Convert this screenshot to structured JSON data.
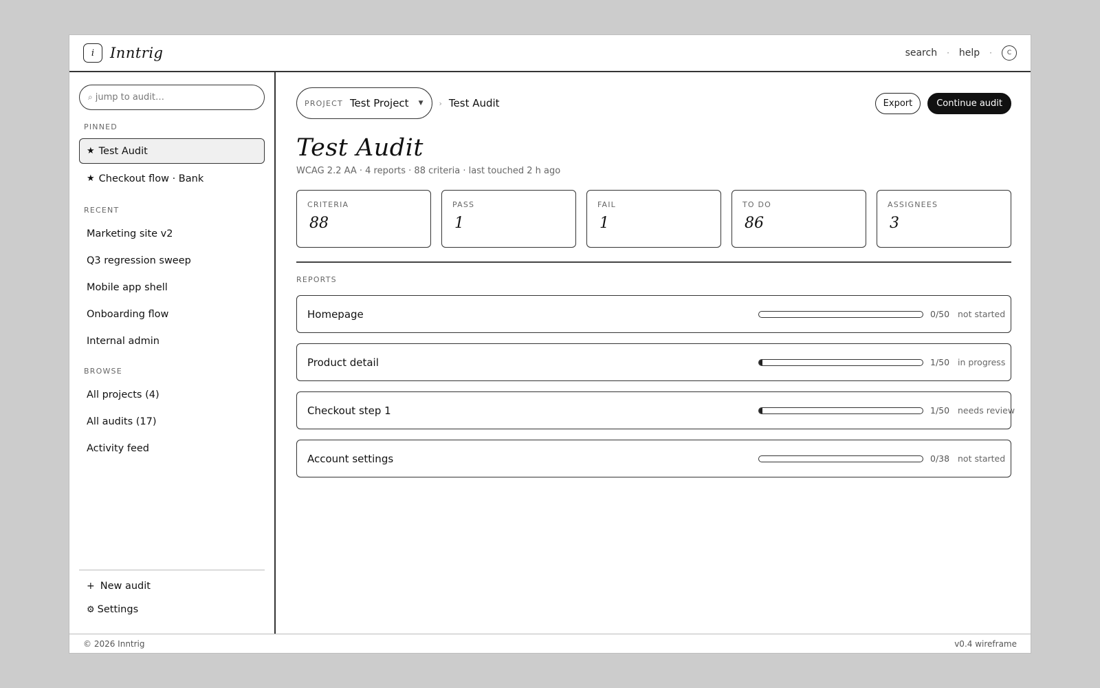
{
  "app": {
    "logo_glyph": "i",
    "brand": "Inntrig"
  },
  "topbar": {
    "search": "search",
    "separator": "·",
    "help": "help",
    "avatar_initial": "C"
  },
  "sidebar": {
    "search_placeholder": "jump to audit…",
    "search_icon": "search-icon",
    "pinned_label": "PINNED",
    "pinned": [
      {
        "label": "Test Audit",
        "active": true
      },
      {
        "label": "Checkout flow · Bank",
        "active": false
      }
    ],
    "recent_label": "RECENT",
    "recent": [
      {
        "label": "Marketing site v2"
      },
      {
        "label": "Q3 regression sweep"
      },
      {
        "label": "Mobile app shell"
      },
      {
        "label": "Onboarding flow"
      },
      {
        "label": "Internal admin"
      }
    ],
    "browse_label": "BROWSE",
    "browse": [
      {
        "label": "All projects (4)"
      },
      {
        "label": "All audits (17)"
      },
      {
        "label": "Activity feed"
      }
    ],
    "new_audit": "New audit",
    "settings": "Settings"
  },
  "breadcrumb": {
    "project_label": "PROJECT",
    "project_value": "Test Project",
    "current": "Test Audit"
  },
  "actions": {
    "export": "Export",
    "continue": "Continue audit"
  },
  "page": {
    "title": "Test Audit",
    "meta": "WCAG 2.2 AA · 4 reports · 88 criteria · last touched 2 h ago"
  },
  "stats": [
    {
      "label": "CRITERIA",
      "value": "88"
    },
    {
      "label": "PASS",
      "value": "1"
    },
    {
      "label": "FAIL",
      "value": "1"
    },
    {
      "label": "TO DO",
      "value": "86"
    },
    {
      "label": "ASSIGNEES",
      "value": "3"
    }
  ],
  "reports_label": "REPORTS",
  "reports": [
    {
      "name": "Homepage",
      "count": "0/50",
      "status": "not started",
      "progress": 0
    },
    {
      "name": "Product detail",
      "count": "1/50",
      "status": "in progress",
      "progress": 0.02
    },
    {
      "name": "Checkout step 1",
      "count": "1/50",
      "status": "needs review",
      "progress": 0.02
    },
    {
      "name": "Account settings",
      "count": "0/38",
      "status": "not started",
      "progress": 0
    }
  ],
  "footer": {
    "copyright": "© 2026 Inntrig",
    "version": "v0.4 wireframe"
  }
}
